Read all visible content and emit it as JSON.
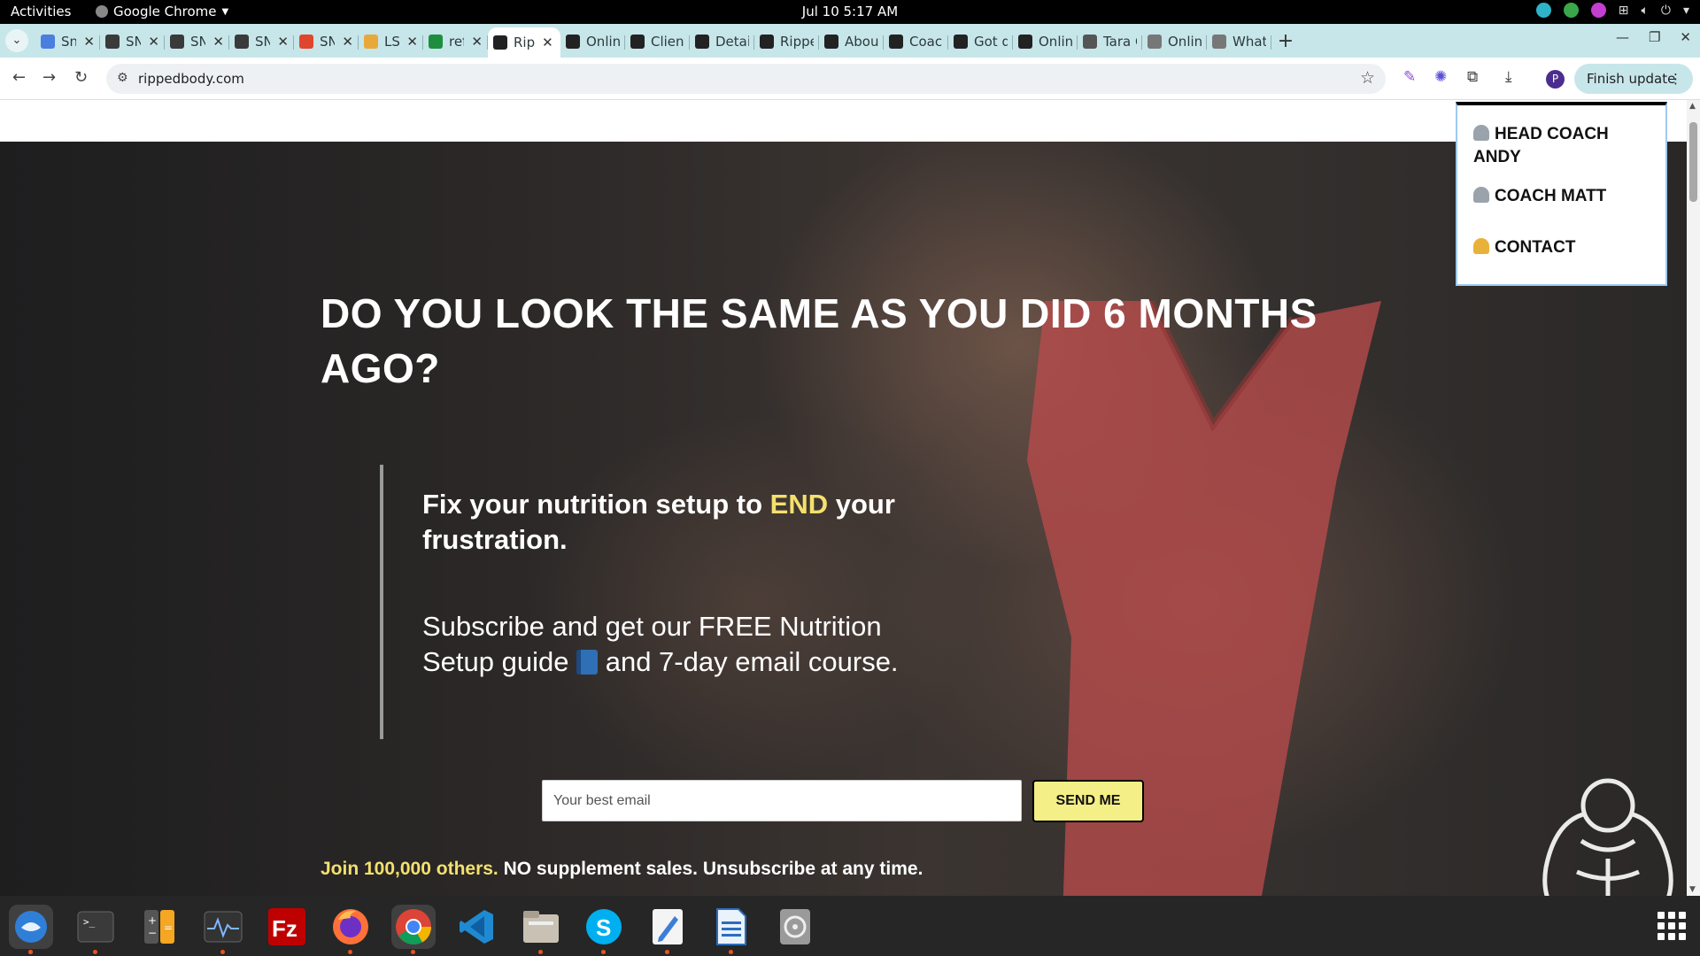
{
  "system_bar": {
    "activities": "Activities",
    "app_name": "Google Chrome",
    "clock": "Jul 10  5:17 AM"
  },
  "tabs": [
    {
      "label": "Sni",
      "icon": "google-docs-icon",
      "color": "#4a7fe0"
    },
    {
      "label": "SN",
      "icon": "snp-icon",
      "color": "#3a3a3a"
    },
    {
      "label": "SN",
      "icon": "snp-icon",
      "color": "#3a3a3a"
    },
    {
      "label": "SN",
      "icon": "snp-icon",
      "color": "#3a3a3a"
    },
    {
      "label": "SN",
      "icon": "red-badge-icon",
      "color": "#e0462e"
    },
    {
      "label": "LS",
      "icon": "multicolor-icon",
      "color": "#e8a93a"
    },
    {
      "label": "ref",
      "icon": "google-sheets-icon",
      "color": "#1e8e3e"
    },
    {
      "label": "Rip",
      "icon": "rippedbody-icon",
      "color": "#222222",
      "active": true
    },
    {
      "label": "Online",
      "icon": "rippedbody-icon",
      "color": "#222222"
    },
    {
      "label": "Client",
      "icon": "rippedbody-icon",
      "color": "#222222"
    },
    {
      "label": "Detail",
      "icon": "rippedbody-icon",
      "color": "#222222"
    },
    {
      "label": "Rippe",
      "icon": "rippedbody-icon",
      "color": "#222222"
    },
    {
      "label": "About",
      "icon": "rippedbody-icon",
      "color": "#222222"
    },
    {
      "label": "Coach",
      "icon": "rippedbody-icon",
      "color": "#222222"
    },
    {
      "label": "Got qu",
      "icon": "rippedbody-icon",
      "color": "#222222"
    },
    {
      "label": "Online",
      "icon": "rippedbody-icon",
      "color": "#222222"
    },
    {
      "label": "Tara C",
      "icon": "globe-icon",
      "color": "#555555"
    },
    {
      "label": "Online",
      "icon": "page-icon",
      "color": "#777777"
    },
    {
      "label": "What",
      "icon": "page-icon",
      "color": "#777777"
    }
  ],
  "toolbar": {
    "url": "rippedbody.com",
    "finish_update": "Finish update",
    "profile_initial": "P"
  },
  "dropdown": {
    "items": [
      "HEAD COACH ANDY",
      "COACH MATT",
      "CONTACT"
    ]
  },
  "hero": {
    "title": "DO YOU LOOK THE SAME AS YOU DID 6 MONTHS AGO?",
    "sub_bold_before": "Fix your nutrition setup to ",
    "sub_bold_highlight": "END",
    "sub_bold_after": " your frustration.",
    "sub_reg_before": "Subscribe and get our FREE Nutrition Setup guide ",
    "sub_reg_after": " and 7-day email course.",
    "email_placeholder": "Your best email",
    "send_label": "SEND ME",
    "join_highlight": "Join 100,000 others.",
    "join_rest": " NO supplement sales. Unsubscribe at any time."
  },
  "colors": {
    "highlight": "#f4e06d",
    "button_bg": "#f4ef86",
    "tabstrip": "#c7e6e9"
  },
  "dock": {
    "apps": [
      "thunderbird-icon",
      "terminal-icon",
      "calculator-icon",
      "system-monitor-icon",
      "filezilla-icon",
      "firefox-icon",
      "chrome-icon",
      "vscode-icon",
      "files-icon",
      "skype-icon",
      "text-editor-icon",
      "libreoffice-writer-icon",
      "disk-utility-icon"
    ]
  }
}
